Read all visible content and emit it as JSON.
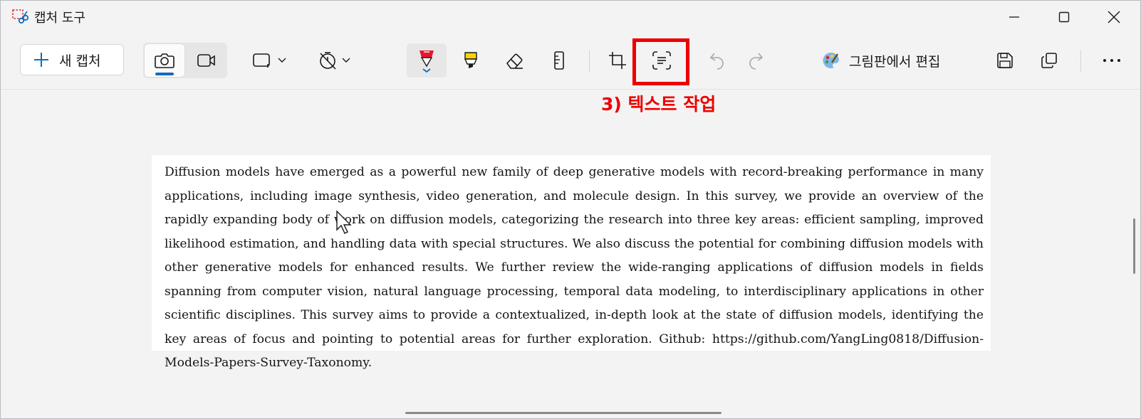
{
  "window": {
    "title": "캡처 도구"
  },
  "toolbar": {
    "new_capture_label": "새 캡처",
    "paint_edit_label": "그림판에서 편집"
  },
  "annotation": {
    "label": "3) 텍스트 작업",
    "color": "#ee0000"
  },
  "captured_text": "Diffusion models have emerged as a powerful new family of deep generative models with record-breaking performance in many applications, including image synthesis, video generation, and molecule design. In this survey, we provide an overview of the rapidly expanding body of work on diffusion models, categorizing the research into three key areas: efficient sampling, improved likelihood estimation, and handling data with special structures. We also discuss the potential for combining diffusion models with other generative models for enhanced results. We further review the wide-ranging applications of diffusion models in fields spanning from computer vision, natural language processing, temporal data modeling, to interdisciplinary applications in other scientific disciplines. This survey aims to provide a contextualized, in-depth look at the state of diffusion models, identifying the key areas of focus and pointing to potential areas for further exploration. Github: https://github.com/YangLing0818/Diffusion-Models-Papers-Survey-Taxonomy.",
  "icons": {
    "app": "snipping-tool-icon",
    "minimize": "minimize-icon",
    "maximize": "maximize-icon",
    "close": "close-icon",
    "plus": "plus-icon",
    "camera": "camera-icon",
    "video": "video-icon",
    "shape": "rectangle-snip-icon",
    "timer": "no-timer-icon",
    "pen": "ballpoint-pen-icon",
    "highlighter": "highlighter-icon",
    "eraser": "eraser-icon",
    "ruler": "ruler-icon",
    "crop": "crop-icon",
    "text_actions": "text-actions-icon",
    "undo": "undo-icon",
    "redo": "redo-icon",
    "paint": "paint-icon",
    "save": "save-icon",
    "copy": "copy-icon",
    "more": "more-icon"
  },
  "colors": {
    "accent": "#0f6cbd",
    "pen": "#e8162e",
    "highlighter": "#ffd400"
  }
}
